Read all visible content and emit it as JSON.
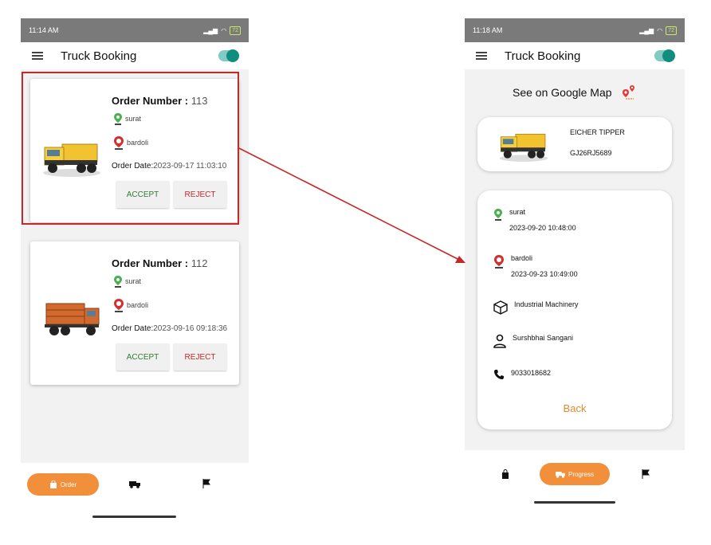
{
  "left_screen": {
    "status": {
      "time": "11:14 AM",
      "battery": "72"
    },
    "app_title": "Truck Booking",
    "orders": [
      {
        "label": "Order Number :",
        "number": "113",
        "from": "surat",
        "to": "bardoli",
        "date_label": "Order Date:",
        "date": "2023-09-17 11:03:10",
        "accept": "ACCEPT",
        "reject": "REJECT",
        "truck": "yellow-tipper-truck"
      },
      {
        "label": "Order Number :",
        "number": "112",
        "from": "surat",
        "to": "bardoli",
        "date_label": "Order Date:",
        "date": "2023-09-16 09:18:36",
        "accept": "ACCEPT",
        "reject": "REJECT",
        "truck": "orange-cargo-truck"
      }
    ],
    "bottom_nav": {
      "active_label": "Order"
    }
  },
  "right_screen": {
    "status": {
      "time": "11:18 AM",
      "battery": "72"
    },
    "app_title": "Truck Booking",
    "map_link": "See on Google Map",
    "truck": {
      "name": "EICHER TIPPER",
      "reg": "GJ26RJ5689"
    },
    "pickup": {
      "place": "surat",
      "datetime": "2023-09-20 10:48:00"
    },
    "drop": {
      "place": "bardoli",
      "datetime": "2023-09-23 10:49:00"
    },
    "goods": "Industrial Machinery",
    "person": "Surshbhai Sangani",
    "phone": "9033018682",
    "back": "Back",
    "bottom_nav": {
      "active_label": "Progress"
    }
  },
  "colors": {
    "accent": "#f28f3b",
    "highlight": "#c62828",
    "accept": "#2e7d32",
    "reject": "#c62828",
    "toggle": "#0f8e80"
  },
  "icons": [
    "menu-icon",
    "pin-green-icon",
    "pin-red-icon",
    "box-icon",
    "person-icon",
    "phone-icon",
    "bag-icon",
    "truck-icon",
    "flag-icon",
    "map-pin-icon"
  ]
}
